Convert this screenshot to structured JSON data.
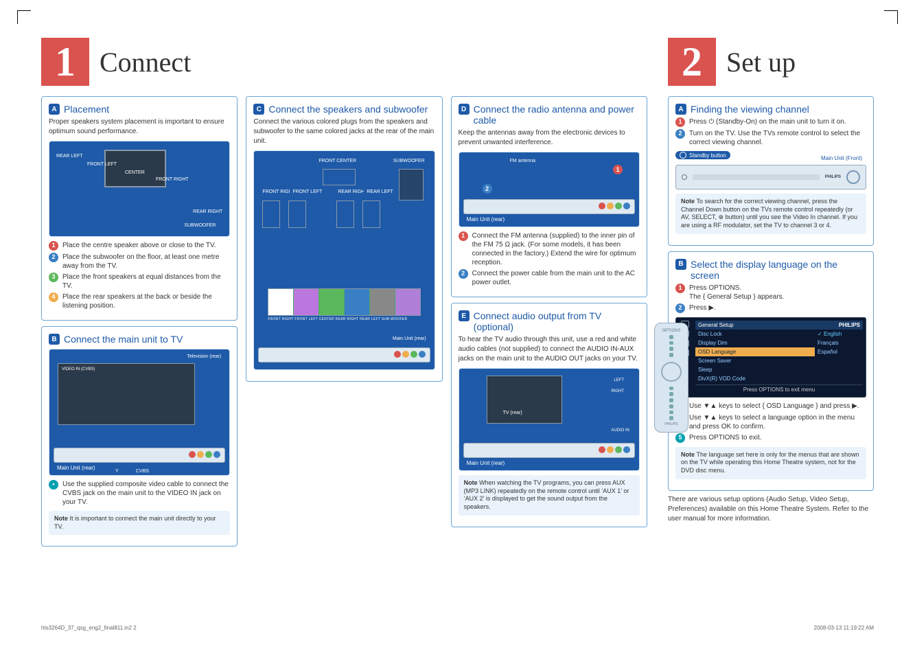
{
  "page1": {
    "num": "1",
    "title": "Connect",
    "A": {
      "letter": "A",
      "title": "Placement",
      "intro": "Proper speakers system placement is important to ensure optimum sound performance.",
      "diagram": {
        "rear_left": "REAR LEFT",
        "front_left": "FRONT LEFT",
        "center": "CENTER",
        "front_right": "FRONT RIGHT",
        "rear_right": "REAR RIGHT",
        "subwoofer": "SUBWOOFER"
      },
      "steps": [
        "Place the centre speaker above or close to the TV.",
        "Place the subwoofer on the floor, at least one metre away from the TV.",
        "Place the front speakers at equal distances from the TV.",
        "Place the rear speakers at the back or beside the listening position."
      ]
    },
    "B": {
      "letter": "B",
      "title": "Connect the main unit to TV",
      "diagram": {
        "tv_rear": "Television (rear)",
        "main_rear": "Main Unit (rear)",
        "video_in": "VIDEO IN (CVBS)",
        "cvbs": "CVBS",
        "y": "Y"
      },
      "bullet": "Use the supplied composite video cable to connect the CVBS jack on the main unit to the VIDEO IN jack on your TV.",
      "note": "It is important to connect the main unit directly to your TV."
    },
    "C": {
      "letter": "C",
      "title": "Connect the speakers and subwoofer",
      "intro": "Connect the various colored plugs from the speakers and subwoofer to the same colored jacks at the rear of the main unit.",
      "diagram": {
        "front_center": "FRONT CENTER",
        "subwoofer": "SUBWOOFER",
        "front_right": "FRONT RIGHT",
        "front_left": "FRONT LEFT",
        "rear_right": "REAR RIGHT",
        "rear_left": "REAR LEFT",
        "main_rear": "Main Unit (rear)",
        "strip": "FRONT RIGHT  FRONT LEFT  CENTER  REAR RIGHT  REAR LEFT  SUB-WOOFER"
      }
    },
    "D": {
      "letter": "D",
      "title": "Connect the radio antenna and power cable",
      "intro": "Keep the antennas away from the electronic devices to prevent unwanted interference.",
      "diagram": {
        "fm": "FM antenna",
        "main_rear": "Main Unit (rear)"
      },
      "steps": [
        "Connect the FM antenna (supplied) to the inner pin of the FM 75 Ω jack. (For some models, it has been connected in the factory.) Extend the wire for optimum reception.",
        "Connect the power cable from the main unit to the AC power outlet."
      ]
    },
    "E": {
      "letter": "E",
      "title": "Connect audio output from TV (optional)",
      "intro": "To hear the TV audio through this unit, use a red and white audio cables (not supplied) to connect the AUDIO IN-AUX jacks on the main unit to the AUDIO OUT jacks on your TV.",
      "diagram": {
        "tv_rear": "TV (rear)",
        "audio_in": "AUDIO IN",
        "main_rear": "Main Unit (rear)",
        "left": "LEFT",
        "right": "RIGHT"
      },
      "note": "When watching the TV programs, you can press AUX (MP3 LINK) repeatedly on the remote control until ‘AUX 1’ or ‘AUX 2’ is displayed to get the sound output from the speakers."
    }
  },
  "page2": {
    "num": "2",
    "title": "Set up",
    "A": {
      "letter": "A",
      "title": "Finding the viewing channel",
      "steps": [
        "Press ⏻ (Standby-On) on the main unit to turn it on.",
        "Turn on the TV. Use the TVs remote control to select the correct viewing channel."
      ],
      "standby_label": "Standby button",
      "main_front": "Main Unit (Front)",
      "brand": "PHILIPS",
      "note": "To search for the correct viewing channel, press the Channel Down button on the TVs remote control repeatedly (or AV, SELECT, ⊕ button) until you see the Video In channel. If you are using a RF modulator, set the TV to channel 3 or 4."
    },
    "B": {
      "letter": "B",
      "title": "Select the display language on the screen",
      "step1": "Press OPTIONS.",
      "step1b": "The { General Setup } appears.",
      "step2": "Press ▶.",
      "osd": {
        "header": "General Setup",
        "brand": "PHILIPS",
        "rows": [
          "Disc Lock",
          "Display Dim",
          "OSD Language",
          "Screen Saver",
          "Sleep",
          "DivX(R) VOD Code"
        ],
        "opts": [
          "English",
          "Français",
          "Español"
        ],
        "footer": "Press OPTIONS to exit menu"
      },
      "steps_rest": [
        "Use ▼▲ keys to select { OSD Language } and press ▶.",
        "Use ▼▲ keys to select a language option in the menu and press OK to confirm.",
        "Press OPTIONS to exit."
      ],
      "note": "The language set here is only for the menus that are shown on the TV while operating this Home Theatre system, not for the DVD disc menu.",
      "closing": "There are various setup options (Audio Setup, Video Setup, Preferences) available on this Home Theatre System. Refer to the user manual for more information."
    },
    "remote": {
      "options": "OPTIONS",
      "brand": "PHILIPS"
    }
  },
  "footer": {
    "left": "hts3264D_37_qsg_eng2_final811.in2   2",
    "right": "2008-03-13   11:19:22 AM"
  },
  "note_word": "Note"
}
